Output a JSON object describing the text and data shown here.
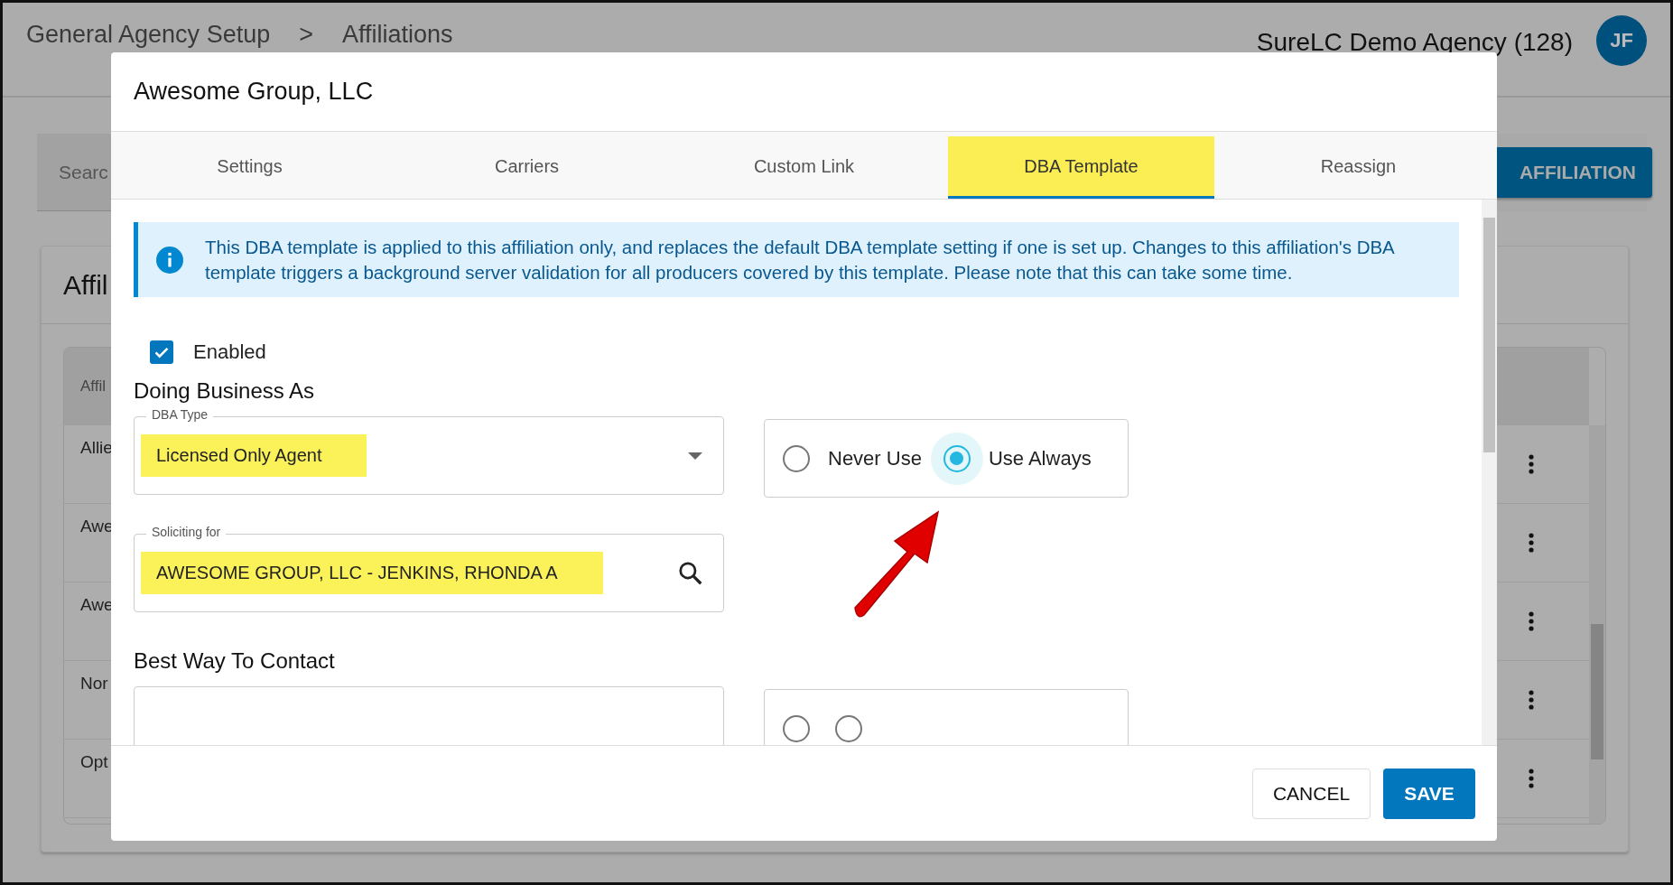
{
  "page": {
    "breadcrumb": [
      "General Agency Setup",
      ">",
      "Affiliations"
    ],
    "agency": "SureLC Demo Agency (128)",
    "avatar": "JF",
    "search": {
      "placeholder": "Searc"
    },
    "add_button": "AFFILIATION",
    "card_title": "Affil",
    "table": {
      "columns": [
        "Affil"
      ],
      "rows": [
        {
          "cell": "Allie"
        },
        {
          "cell": "Awe"
        },
        {
          "cell": "Awe"
        },
        {
          "cell": "Nor"
        },
        {
          "cell": "Opt"
        }
      ]
    }
  },
  "dialog": {
    "title": "Awesome Group, LLC",
    "tabs": [
      {
        "label": "Settings",
        "selected": false,
        "highlighted": false
      },
      {
        "label": "Carriers",
        "selected": false,
        "highlighted": false
      },
      {
        "label": "Custom Link",
        "selected": false,
        "highlighted": false
      },
      {
        "label": "DBA Template",
        "selected": true,
        "highlighted": true
      },
      {
        "label": "Reassign",
        "selected": false,
        "highlighted": false
      }
    ],
    "info": "This DBA template is applied to this affiliation only, and replaces the default DBA template setting if one is set up. Changes to this affiliation's DBA template triggers a background server validation for all producers covered by this template. Please note that this can take some time.",
    "enabled": {
      "label": "Enabled",
      "checked": true
    },
    "sections": [
      {
        "title": "Doing Business As",
        "rows": [
          {
            "field": {
              "kind": "dropdown",
              "label": "DBA Type",
              "value": "Licensed Only Agent",
              "highlighted": true
            },
            "radios": [
              {
                "label": "Never Use",
                "selected": false
              },
              {
                "label": "Use Always",
                "selected": true
              }
            ]
          },
          {
            "field": {
              "kind": "search",
              "label": "Soliciting for",
              "value": "AWESOME GROUP, LLC - JENKINS, RHONDA A",
              "highlighted": true
            }
          }
        ]
      },
      {
        "title": "Best Way To Contact",
        "rows": [
          {
            "field": {
              "kind": "blank"
            },
            "radios": [
              {
                "selected": false
              },
              {
                "selected": false
              }
            ]
          }
        ]
      }
    ],
    "buttons": {
      "cancel": "CANCEL",
      "save": "SAVE"
    }
  }
}
